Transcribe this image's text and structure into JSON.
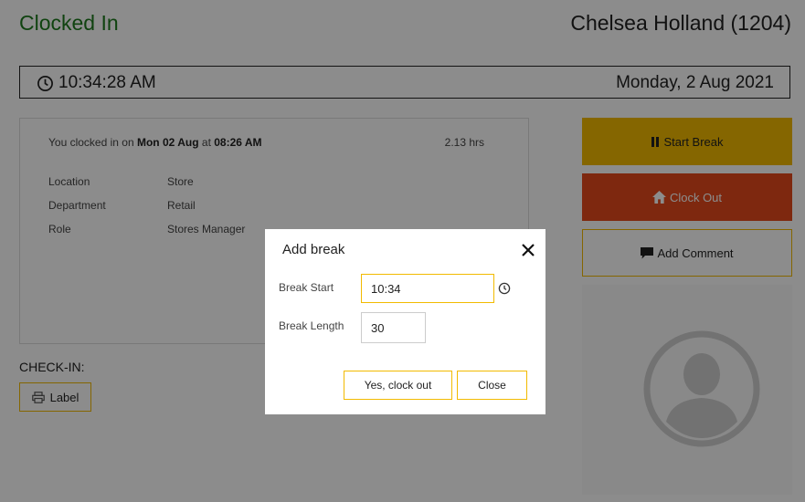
{
  "header": {
    "status": "Clocked In",
    "user": "Chelsea Holland (1204)",
    "time": "10:34:28 AM",
    "date": "Monday, 2 Aug 2021"
  },
  "shift": {
    "clocked_prefix": "You clocked in on",
    "clocked_date": "Mon 02 Aug",
    "clocked_at": "at",
    "clocked_time": "08:26 AM",
    "hours": "2.13 hrs",
    "details": [
      {
        "label": "Location",
        "value": "Store"
      },
      {
        "label": "Department",
        "value": "Retail"
      },
      {
        "label": "Role",
        "value": "Stores Manager"
      }
    ]
  },
  "actions": {
    "start_break": "Start Break",
    "clock_out": "Clock Out",
    "add_comment": "Add Comment"
  },
  "checkin": {
    "heading": "CHECK-IN:",
    "label_button": "Label"
  },
  "modal": {
    "title": "Add break",
    "break_start_label": "Break Start",
    "break_start_value": "10:34",
    "break_length_label": "Break Length",
    "break_length_value": "30",
    "confirm_button": "Yes, clock out",
    "close_button": "Close"
  },
  "colors": {
    "status_green": "#1e7a1e",
    "accent_yellow": "#f2ba00",
    "clock_out_red": "#e54a1c"
  },
  "icons": [
    "clock-icon",
    "pause-icon",
    "home-icon",
    "comment-icon",
    "avatar-icon",
    "label-printer-icon",
    "close-icon"
  ]
}
